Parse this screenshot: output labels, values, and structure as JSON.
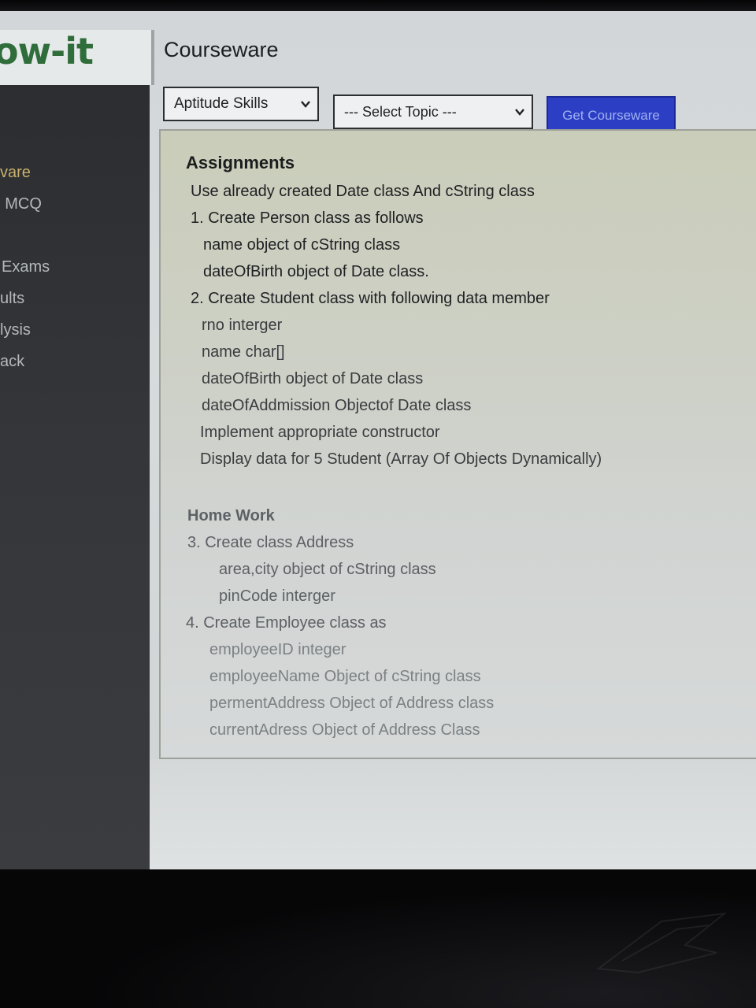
{
  "app": {
    "logo_text": "ow-it",
    "page_title": "Courseware"
  },
  "sidebar": {
    "items": [
      {
        "label": "vare",
        "active": true
      },
      {
        "label": "MCQ",
        "active": false
      },
      {
        "label": "Exams",
        "active": false
      },
      {
        "label": "ults",
        "active": false
      },
      {
        "label": "lysis",
        "active": false
      },
      {
        "label": "ack",
        "active": false
      }
    ]
  },
  "toolbar": {
    "course_select": {
      "selected": "Aptitude Skills"
    },
    "topic_select": {
      "selected": "--- Select Topic ---"
    },
    "get_button_label": "Get Courseware"
  },
  "content": {
    "assignments_heading": "Assignments",
    "lines": [
      "Use already created Date class And cString class",
      "1. Create Person class as follows",
      "name object of cString class",
      "dateOfBirth object of Date class.",
      "2. Create Student class with following data member",
      "rno interger",
      "name char[]",
      "dateOfBirth object of Date class",
      "dateOfAddmission Objectof Date class",
      "Implement appropriate constructor",
      "Display data for 5 Student (Array Of Objects Dynamically)"
    ],
    "homework_heading": "Home Work",
    "homework_lines": [
      "3. Create class Address",
      "area,city object of cString class",
      "pinCode interger",
      "4. Create Employee class as",
      "employeeID integer",
      "employeeName  Object of cString class",
      "permentAddress Object of Address class",
      "currentAdress Object of Address Class"
    ]
  },
  "colors": {
    "logo_green": "#2f6d3a",
    "button_blue": "#2c3fc4",
    "sidebar_active": "#c8b26a"
  }
}
